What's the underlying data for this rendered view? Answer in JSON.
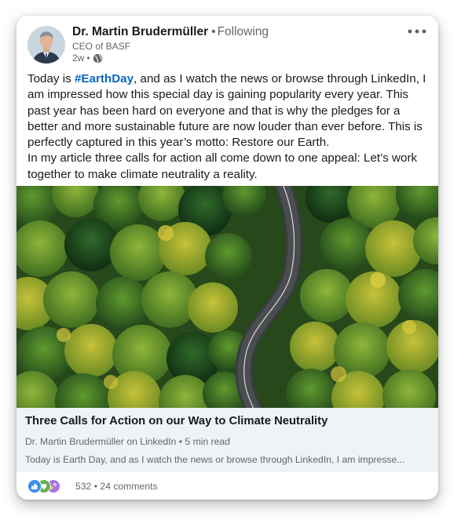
{
  "post": {
    "author_name": "Dr. Martin Brudermüller",
    "follow_status": "Following",
    "author_title": "CEO of BASF",
    "timestamp": "2w",
    "visibility_icon": "globe-icon",
    "more_icon": "more-horizontal-icon",
    "text_line1_before": "Today is ",
    "hashtag": "#EarthDay",
    "text_line1_after": ", and as I watch the news or browse through LinkedIn, I am impressed how this special day is gaining popularity every year. This past year has been hard on everyone and that is why the pledges for a better and more sustainable future are now louder than ever before. This is perfectly captured in this year’s motto: Restore our Earth.",
    "text_paragraph2": "In my article three calls for action all come down to one appeal: Let’s work together to make climate neutrality a reality."
  },
  "article": {
    "title": "Three Calls for Action on our Way to Climate Neutrality",
    "meta": "Dr. Martin Brudermüller on LinkedIn • 5 min read",
    "snippet": "Today is Earth Day, and as I watch the news or browse through LinkedIn, I am impresse..."
  },
  "social": {
    "reaction_icons": [
      "like-icon",
      "support-icon",
      "celebrate-icon"
    ],
    "counts": "532 • 24 comments"
  },
  "colors": {
    "hashtag": "#0a66c2",
    "like": "#378fe9",
    "support": "#6dae4f",
    "celebrate": "#a872e8"
  }
}
